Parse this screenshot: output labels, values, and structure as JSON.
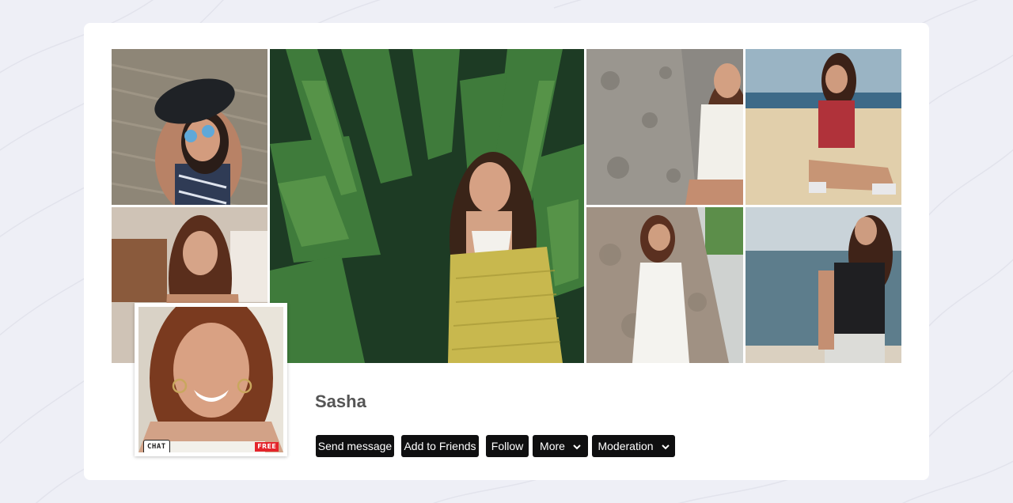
{
  "profile": {
    "name": "Sasha",
    "avatar_badges": {
      "chat": "CHAT",
      "free": "FREE"
    }
  },
  "actions": {
    "send_message": "Send message",
    "add_to_friends": "Add to Friends",
    "follow": "Follow",
    "more": "More",
    "moderation": "Moderation"
  },
  "gallery": [
    "photo-1",
    "photo-2",
    "photo-3",
    "photo-4",
    "photo-5",
    "photo-6",
    "photo-7",
    "photo-8"
  ],
  "icons": {
    "dropdown": "chevron-down-icon"
  },
  "colors": {
    "page_background": "#eeeff6",
    "card_background": "#ffffff",
    "button_background": "#0f0f10",
    "button_text": "#ffffff",
    "name_text": "#555555",
    "free_badge": "#e4242b"
  }
}
